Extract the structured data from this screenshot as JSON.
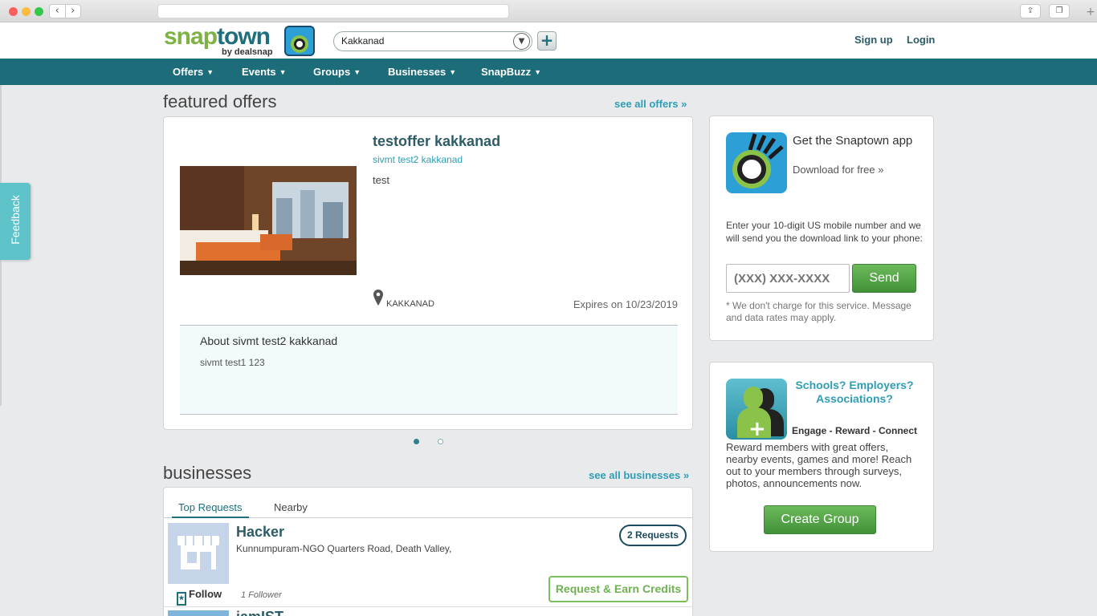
{
  "header": {
    "logo_text_snap": "snap",
    "logo_text_town": "town",
    "logo_by": "by dealsnap",
    "city_value": "Kakkanad",
    "signup": "Sign up",
    "login": "Login"
  },
  "nav": {
    "items": [
      {
        "label": "Offers"
      },
      {
        "label": "Events"
      },
      {
        "label": "Groups"
      },
      {
        "label": "Businesses"
      },
      {
        "label": "SnapBuzz"
      }
    ]
  },
  "feedback": "Feedback",
  "featured": {
    "title": "featured offers",
    "see_all": "see all offers",
    "offer": {
      "title": "testoffer kakkanad",
      "business": "sivmt test2 kakkanad",
      "description": "test",
      "location": "KAKKANAD",
      "expires": "Expires on 10/23/2019",
      "about_title": "About sivmt test2 kakkanad",
      "about_text": "sivmt test1 123"
    }
  },
  "businesses": {
    "title": "businesses",
    "see_all": "see all businesses",
    "tabs": [
      {
        "label": "Top Requests"
      },
      {
        "label": "Nearby"
      }
    ],
    "items": [
      {
        "name": "Hacker",
        "address": "Kunnumpuram-NGO Quarters Road, Death Valley,",
        "requests": "2 Requests",
        "earn": "Request & Earn Credits",
        "follow": "Follow",
        "followers": "1 Follower"
      },
      {
        "name": "iamIST"
      }
    ]
  },
  "app_promo": {
    "title": "Get the Snaptown app",
    "download": "Download for free",
    "info": "Enter your 10-digit US mobile number and we will send you the download link to your phone:",
    "placeholder": "(XXX) XXX-XXXX",
    "send": "Send",
    "disclaimer": "* We don't charge for this service. Message and data rates may apply."
  },
  "groups_promo": {
    "title": "Schools? Employers? Associations?",
    "tagline": "Engage - Reward - Connect",
    "text": "Reward members with great offers, nearby events, games and more! Reach out to your members through surveys, photos, announcements now.",
    "button": "Create Group"
  },
  "colors": {
    "nav": "#1c6c79",
    "accent": "#2f9db4",
    "green": "#42913a"
  }
}
